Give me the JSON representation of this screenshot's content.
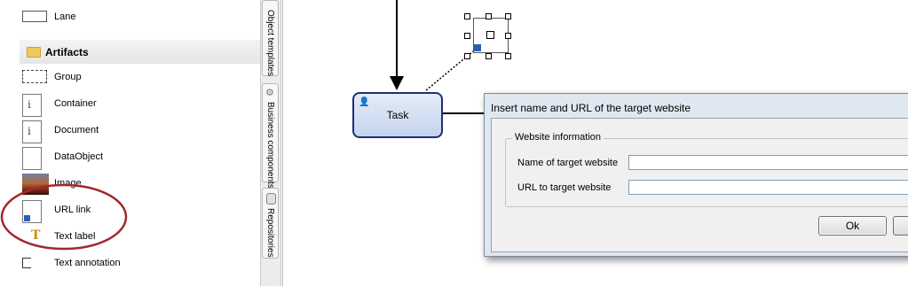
{
  "palette": {
    "items": [
      {
        "label": "Lane",
        "icon": "lane-icon"
      },
      {
        "label": "Group",
        "icon": "group-icon"
      },
      {
        "label": "Container",
        "icon": "container-icon"
      },
      {
        "label": "Document",
        "icon": "document-icon"
      },
      {
        "label": "DataObject",
        "icon": "dataobject-icon"
      },
      {
        "label": "Image",
        "icon": "image-icon"
      },
      {
        "label": "URL link",
        "icon": "url-link-icon"
      },
      {
        "label": "Text label",
        "icon": "text-label-icon"
      },
      {
        "label": "Text annotation",
        "icon": "text-annotation-icon"
      }
    ],
    "section_header": "Artifacts",
    "doc_glyph": "i",
    "text_glyph": "T"
  },
  "tabs": [
    "Object templates",
    "Business components",
    "Repositories"
  ],
  "canvas": {
    "task_label": "Task"
  },
  "dialog": {
    "title": "Insert name and URL of the target website",
    "group_label": "Website information",
    "name_label": "Name of target website",
    "url_label": "URL to target website",
    "name_value": "",
    "url_value": "",
    "ok_label": "Ok"
  },
  "colors": {
    "annotation": "#a3282a",
    "task_border": "#1e2f74",
    "dialog_frame": "#dfe8f1"
  }
}
